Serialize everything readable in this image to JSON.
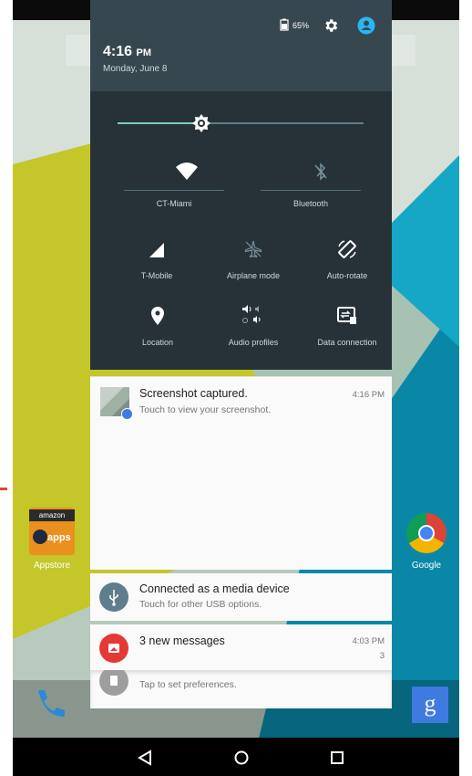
{
  "status": {
    "battery_percent": "65%"
  },
  "header": {
    "time": "4:16",
    "ampm": "PM",
    "date": "Monday, June 8"
  },
  "brightness": {
    "level": 0.34
  },
  "tiles": [
    {
      "label": "CT-Miami",
      "icon": "wifi-icon"
    },
    {
      "label": "Bluetooth",
      "icon": "bluetooth-off-icon"
    },
    {
      "label": "T-Mobile",
      "icon": "cell-signal-icon"
    },
    {
      "label": "Airplane mode",
      "icon": "airplane-icon"
    },
    {
      "label": "Auto-rotate",
      "icon": "auto-rotate-icon"
    },
    {
      "label": "Location",
      "icon": "location-icon"
    },
    {
      "label": "Audio profiles",
      "icon": "audio-profiles-icon"
    },
    {
      "label": "Data connection",
      "icon": "data-connection-icon"
    }
  ],
  "notifications": [
    {
      "title": "Screenshot captured.",
      "text": "Touch to view your screenshot.",
      "time": "4:16 PM"
    },
    {
      "title": "Connected as a media device",
      "text": "Touch for other USB options.",
      "time": ""
    },
    {
      "title": "3 new messages",
      "text": "",
      "time": "4:03 PM",
      "count": "3"
    },
    {
      "title": "",
      "text": "Tap to set preferences.",
      "time": ""
    }
  ],
  "home": {
    "appstore_label": "Appstore",
    "amazon_text": "amazon",
    "apps_text": "apps",
    "google_label": "Google"
  }
}
